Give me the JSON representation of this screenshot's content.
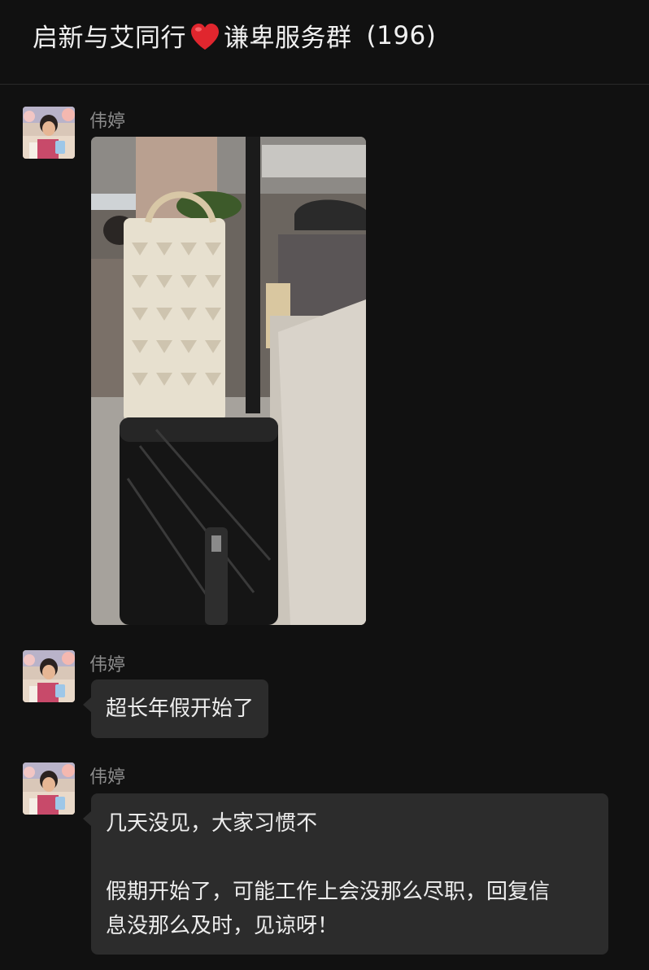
{
  "header": {
    "title_before": "启新与艾同行",
    "heart_icon": "red-heart-emoji",
    "title_after": "谦卑服务群",
    "member_count": "(196)"
  },
  "colors": {
    "background": "#111111",
    "bubble": "#2c2c2c",
    "sender": "#8c8c8c",
    "heart": "#e0262e"
  },
  "messages": [
    {
      "sender": "伟婷",
      "type": "image",
      "image_description": "photo"
    },
    {
      "sender": "伟婷",
      "type": "text",
      "text": "超长年假开始了"
    },
    {
      "sender": "伟婷",
      "type": "text",
      "line1": "几天没见，大家习惯不",
      "line2": "假期开始了，可能工作上会没那么尽职，回复信",
      "line3": "息没那么及时，见谅呀！"
    }
  ]
}
